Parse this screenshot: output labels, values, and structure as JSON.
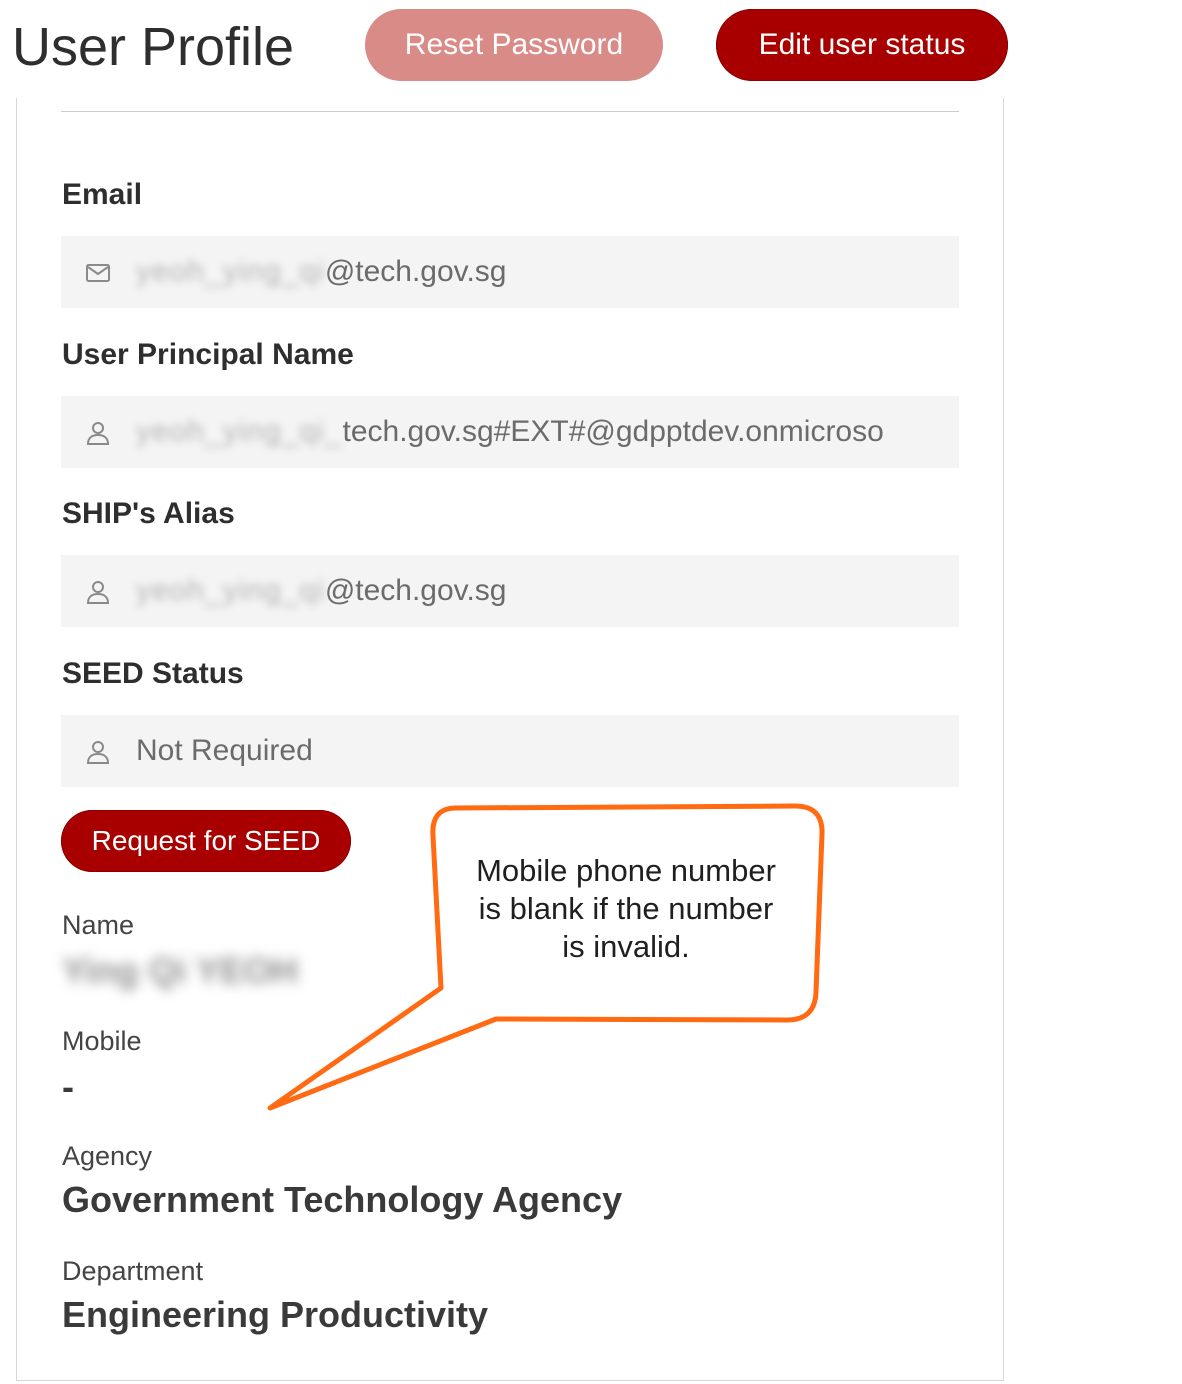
{
  "header": {
    "title": "User Profile",
    "reset_password_label": "Reset Password",
    "edit_status_label": "Edit user status"
  },
  "fields": {
    "email": {
      "label": "Email",
      "value_redacted": "yeoh_ying_qi",
      "value_suffix": "@tech.gov.sg",
      "icon": "mail-icon"
    },
    "upn": {
      "label": "User Principal Name",
      "value_redacted": "yeoh_ying_qi_",
      "value_suffix": "tech.gov.sg#EXT#@gdpptdev.onmicroso",
      "icon": "user-icon"
    },
    "alias": {
      "label": "SHIP's Alias",
      "value_redacted": "yeoh_ying_qi",
      "value_suffix": "@tech.gov.sg",
      "icon": "user-icon"
    },
    "seed_status": {
      "label": "SEED Status",
      "value": "Not Required",
      "icon": "user-icon"
    }
  },
  "seed_button_label": "Request for SEED",
  "details": {
    "name_label": "Name",
    "name_value": "Ying Qi YEOH",
    "mobile_label": "Mobile",
    "mobile_value": "-",
    "agency_label": "Agency",
    "agency_value": "Government Technology Agency",
    "department_label": "Department",
    "department_value": "Engineering Productivity"
  },
  "callout": {
    "line1": "Mobile phone number",
    "line2": "is blank if the number",
    "line3": "is invalid.",
    "color": "#ff6a13"
  },
  "colors": {
    "primary": "#a80000",
    "primary_disabled": "#d98b87",
    "field_bg": "#f4f4f4"
  }
}
